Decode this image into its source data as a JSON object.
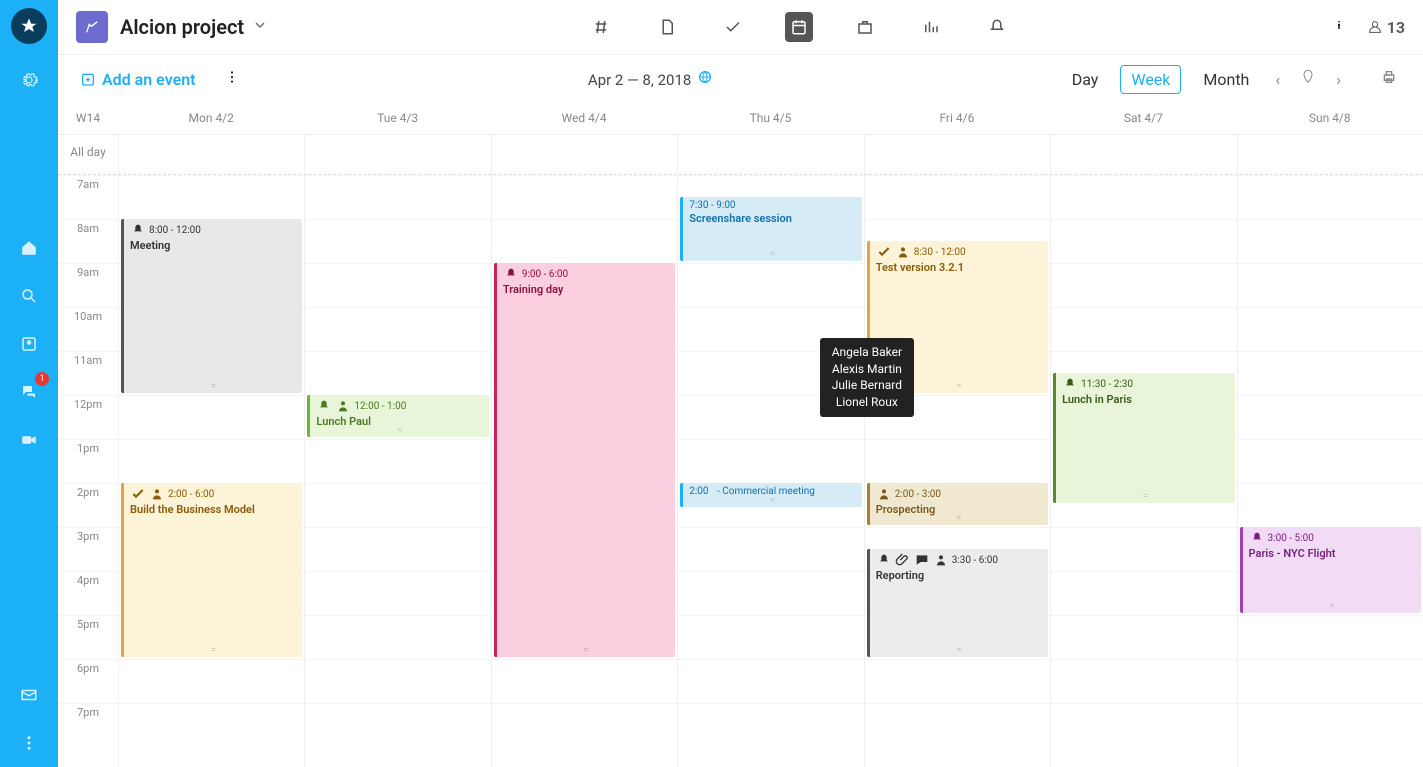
{
  "project": {
    "name": "Alcion project"
  },
  "userCount": "13",
  "toolbar": {
    "addEvent": "Add an event",
    "dateRange": "Apr 2 — 8, 2018",
    "views": {
      "day": "Day",
      "week": "Week",
      "month": "Month"
    }
  },
  "chatBadge": "1",
  "calendar": {
    "weekLabel": "W14",
    "alldayLabel": "All day",
    "days": [
      "Mon 4/2",
      "Tue 4/3",
      "Wed 4/4",
      "Thu 4/5",
      "Fri 4/6",
      "Sat 4/7",
      "Sun 4/8"
    ],
    "hours": [
      "7am",
      "8am",
      "9am",
      "10am",
      "11am",
      "12pm",
      "1pm",
      "2pm",
      "3pm",
      "4pm",
      "5pm",
      "6pm",
      "7pm"
    ]
  },
  "events": [
    {
      "day": 0,
      "start": 8,
      "end": 12,
      "time": "8:00 - 12:00",
      "title": "Meeting",
      "bg": "#e8e8e8",
      "border": "#555",
      "color": "#333",
      "icons": [
        "bell"
      ]
    },
    {
      "day": 0,
      "start": 14,
      "end": 18,
      "time": "2:00 - 6:00",
      "title": "Build the Business Model",
      "bg": "#fdf3d8",
      "border": "#e8a33d",
      "color": "#8a5a00",
      "icons": [
        "check",
        "user"
      ]
    },
    {
      "day": 1,
      "start": 12,
      "end": 13,
      "time": "12:00 - 1:00",
      "title": "Lunch Paul",
      "bg": "#e8f5d8",
      "border": "#6fb536",
      "color": "#4a7a1f",
      "icons": [
        "bell",
        "user"
      ]
    },
    {
      "day": 2,
      "start": 9,
      "end": 18,
      "time": "9:00 - 6:00",
      "title": "Training day",
      "bg": "#fbcfe0",
      "border": "#c8205a",
      "color": "#8a1240",
      "icons": [
        "bell"
      ]
    },
    {
      "day": 3,
      "start": 7.5,
      "end": 9,
      "time": "7:30 - 9:00",
      "title": "Screenshare session",
      "bg": "#d5ecf7",
      "border": "#1cb0f6",
      "color": "#1170a8",
      "icons": []
    },
    {
      "day": 3,
      "start": 14,
      "end": 14.6,
      "time": "2:00",
      "title": "- Commercial meeting",
      "bg": "#d5ecf7",
      "border": "#1cb0f6",
      "color": "#1170a8",
      "icons": [],
      "inline": true
    },
    {
      "day": 4,
      "start": 8.5,
      "end": 12,
      "time": "8:30 - 12:00",
      "title": "Test version 3.2.1",
      "bg": "#fdf3d8",
      "border": "#e8a33d",
      "color": "#8a5a00",
      "icons": [
        "check",
        "user"
      ]
    },
    {
      "day": 4,
      "start": 14,
      "end": 15,
      "time": "2:00 - 3:00",
      "title": "Prospecting",
      "bg": "#f0e8d0",
      "border": "#a87f2e",
      "color": "#7a5a1a",
      "icons": [
        "user"
      ]
    },
    {
      "day": 4,
      "start": 15.5,
      "end": 18,
      "time": "3:30 - 6:00",
      "title": "Reporting",
      "bg": "#ececec",
      "border": "#555",
      "color": "#333",
      "icons": [
        "bell",
        "clip",
        "chat",
        "user"
      ]
    },
    {
      "day": 5,
      "start": 11.5,
      "end": 14.5,
      "time": "11:30 - 2:30",
      "title": "Lunch in Paris",
      "bg": "#e8f5d8",
      "border": "#5a8a2a",
      "color": "#3a5a1a",
      "icons": [
        "bell"
      ]
    },
    {
      "day": 6,
      "start": 15,
      "end": 17,
      "time": "3:00 - 5:00",
      "title": "Paris - NYC Flight",
      "bg": "#f2dcf5",
      "border": "#a83fae",
      "color": "#7a1f80",
      "icons": [
        "bell"
      ]
    }
  ],
  "tooltip": {
    "lines": [
      "Angela Baker",
      "Alexis Martin",
      "Julie Bernard",
      "Lionel Roux"
    ],
    "day": 4,
    "top": 10.7
  }
}
